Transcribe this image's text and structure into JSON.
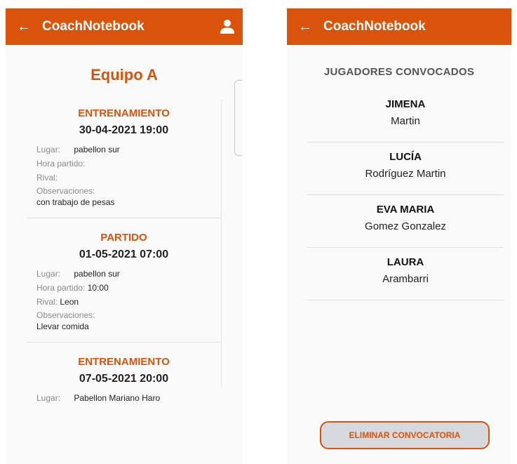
{
  "colors": {
    "primary": "#d9530b",
    "appbar_text": "#ffffff"
  },
  "left": {
    "appbar": {
      "back_icon": "arrow-left-icon",
      "title": "CoachNotebook",
      "user_icon": "person-icon"
    },
    "team_title": "Equipo A",
    "events": [
      {
        "type": "ENTRENAMIENTO",
        "date": "30-04-2021 19:00",
        "lugar_label": "Lugar:",
        "lugar": "pabellon sur",
        "hora_label": "Hora partido:",
        "hora": "",
        "rival_label": "Rival:",
        "rival": "",
        "obs_label": "Observaciones:",
        "obs": "con trabajo de pesas"
      },
      {
        "type": "PARTIDO",
        "date": "01-05-2021 07:00",
        "lugar_label": "Lugar:",
        "lugar": "pabellon sur",
        "hora_label": "Hora partido:",
        "hora": "10:00",
        "rival_label": "Rival:",
        "rival": "Leon",
        "obs_label": "Observaciones:",
        "obs": "Llevar comida"
      },
      {
        "type": "ENTRENAMIENTO",
        "date": "07-05-2021 20:00",
        "lugar_label": "Lugar:",
        "lugar": "Pabellon Mariano Haro"
      }
    ]
  },
  "right": {
    "appbar": {
      "back_icon": "arrow-left-icon",
      "title": "CoachNotebook"
    },
    "section_title": "JUGADORES CONVOCADOS",
    "players": [
      {
        "first": "JIMENA",
        "last": "Martin"
      },
      {
        "first": "LUCÍA",
        "last": "Rodríguez Martin"
      },
      {
        "first": "EVA MARIA",
        "last": "Gomez Gonzalez"
      },
      {
        "first": "LAURA",
        "last": "Arambarri"
      }
    ],
    "delete_button": "ELIMINAR CONVOCATORIA"
  }
}
